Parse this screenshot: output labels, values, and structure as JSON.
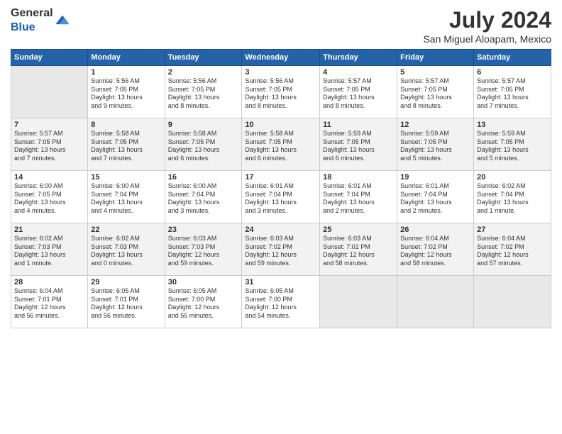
{
  "header": {
    "logo_line1": "General",
    "logo_line2": "Blue",
    "month_title": "July 2024",
    "subtitle": "San Miguel Aloapam, Mexico"
  },
  "columns": [
    "Sunday",
    "Monday",
    "Tuesday",
    "Wednesday",
    "Thursday",
    "Friday",
    "Saturday"
  ],
  "weeks": [
    [
      {
        "day": "",
        "info": ""
      },
      {
        "day": "1",
        "info": "Sunrise: 5:56 AM\nSunset: 7:05 PM\nDaylight: 13 hours\nand 9 minutes."
      },
      {
        "day": "2",
        "info": "Sunrise: 5:56 AM\nSunset: 7:05 PM\nDaylight: 13 hours\nand 8 minutes."
      },
      {
        "day": "3",
        "info": "Sunrise: 5:56 AM\nSunset: 7:05 PM\nDaylight: 13 hours\nand 8 minutes."
      },
      {
        "day": "4",
        "info": "Sunrise: 5:57 AM\nSunset: 7:05 PM\nDaylight: 13 hours\nand 8 minutes."
      },
      {
        "day": "5",
        "info": "Sunrise: 5:57 AM\nSunset: 7:05 PM\nDaylight: 13 hours\nand 8 minutes."
      },
      {
        "day": "6",
        "info": "Sunrise: 5:57 AM\nSunset: 7:05 PM\nDaylight: 13 hours\nand 7 minutes."
      }
    ],
    [
      {
        "day": "7",
        "info": "Sunrise: 5:57 AM\nSunset: 7:05 PM\nDaylight: 13 hours\nand 7 minutes."
      },
      {
        "day": "8",
        "info": "Sunrise: 5:58 AM\nSunset: 7:05 PM\nDaylight: 13 hours\nand 7 minutes."
      },
      {
        "day": "9",
        "info": "Sunrise: 5:58 AM\nSunset: 7:05 PM\nDaylight: 13 hours\nand 6 minutes."
      },
      {
        "day": "10",
        "info": "Sunrise: 5:58 AM\nSunset: 7:05 PM\nDaylight: 13 hours\nand 6 minutes."
      },
      {
        "day": "11",
        "info": "Sunrise: 5:59 AM\nSunset: 7:05 PM\nDaylight: 13 hours\nand 6 minutes."
      },
      {
        "day": "12",
        "info": "Sunrise: 5:59 AM\nSunset: 7:05 PM\nDaylight: 13 hours\nand 5 minutes."
      },
      {
        "day": "13",
        "info": "Sunrise: 5:59 AM\nSunset: 7:05 PM\nDaylight: 13 hours\nand 5 minutes."
      }
    ],
    [
      {
        "day": "14",
        "info": "Sunrise: 6:00 AM\nSunset: 7:05 PM\nDaylight: 13 hours\nand 4 minutes."
      },
      {
        "day": "15",
        "info": "Sunrise: 6:00 AM\nSunset: 7:04 PM\nDaylight: 13 hours\nand 4 minutes."
      },
      {
        "day": "16",
        "info": "Sunrise: 6:00 AM\nSunset: 7:04 PM\nDaylight: 13 hours\nand 3 minutes."
      },
      {
        "day": "17",
        "info": "Sunrise: 6:01 AM\nSunset: 7:04 PM\nDaylight: 13 hours\nand 3 minutes."
      },
      {
        "day": "18",
        "info": "Sunrise: 6:01 AM\nSunset: 7:04 PM\nDaylight: 13 hours\nand 2 minutes."
      },
      {
        "day": "19",
        "info": "Sunrise: 6:01 AM\nSunset: 7:04 PM\nDaylight: 13 hours\nand 2 minutes."
      },
      {
        "day": "20",
        "info": "Sunrise: 6:02 AM\nSunset: 7:04 PM\nDaylight: 13 hours\nand 1 minute."
      }
    ],
    [
      {
        "day": "21",
        "info": "Sunrise: 6:02 AM\nSunset: 7:03 PM\nDaylight: 13 hours\nand 1 minute."
      },
      {
        "day": "22",
        "info": "Sunrise: 6:02 AM\nSunset: 7:03 PM\nDaylight: 13 hours\nand 0 minutes."
      },
      {
        "day": "23",
        "info": "Sunrise: 6:03 AM\nSunset: 7:03 PM\nDaylight: 12 hours\nand 59 minutes."
      },
      {
        "day": "24",
        "info": "Sunrise: 6:03 AM\nSunset: 7:02 PM\nDaylight: 12 hours\nand 59 minutes."
      },
      {
        "day": "25",
        "info": "Sunrise: 6:03 AM\nSunset: 7:02 PM\nDaylight: 12 hours\nand 58 minutes."
      },
      {
        "day": "26",
        "info": "Sunrise: 6:04 AM\nSunset: 7:02 PM\nDaylight: 12 hours\nand 58 minutes."
      },
      {
        "day": "27",
        "info": "Sunrise: 6:04 AM\nSunset: 7:02 PM\nDaylight: 12 hours\nand 57 minutes."
      }
    ],
    [
      {
        "day": "28",
        "info": "Sunrise: 6:04 AM\nSunset: 7:01 PM\nDaylight: 12 hours\nand 56 minutes."
      },
      {
        "day": "29",
        "info": "Sunrise: 6:05 AM\nSunset: 7:01 PM\nDaylight: 12 hours\nand 56 minutes."
      },
      {
        "day": "30",
        "info": "Sunrise: 6:05 AM\nSunset: 7:00 PM\nDaylight: 12 hours\nand 55 minutes."
      },
      {
        "day": "31",
        "info": "Sunrise: 6:05 AM\nSunset: 7:00 PM\nDaylight: 12 hours\nand 54 minutes."
      },
      {
        "day": "",
        "info": ""
      },
      {
        "day": "",
        "info": ""
      },
      {
        "day": "",
        "info": ""
      }
    ]
  ]
}
